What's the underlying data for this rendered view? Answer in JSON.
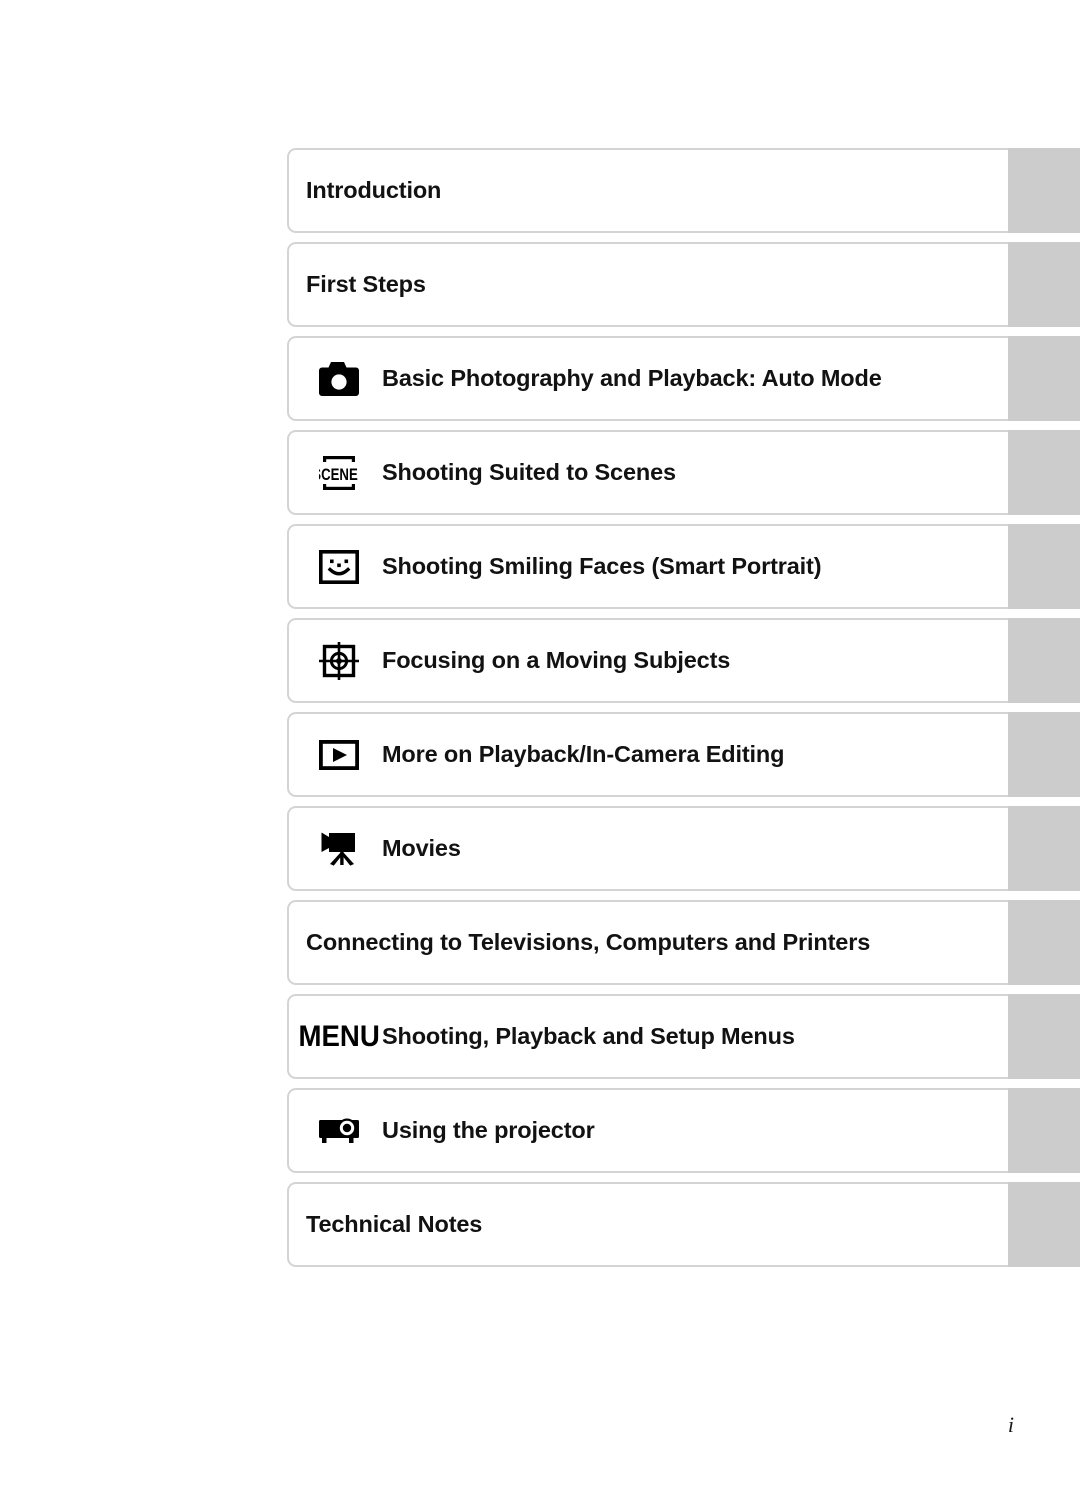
{
  "page": {
    "folio": "i",
    "background_color": "#ffffff",
    "tab_color": "#cccccc",
    "box_border_color": "#d4d4d4",
    "text_color": "#121212"
  },
  "contents": {
    "rows": [
      {
        "icon": "none",
        "label": "Introduction"
      },
      {
        "icon": "none",
        "label": "First Steps"
      },
      {
        "icon": "camera-icon",
        "label": "Basic Photography and Playback: Auto Mode"
      },
      {
        "icon": "scene-icon",
        "label": "Shooting Suited to Scenes"
      },
      {
        "icon": "smile-face-icon",
        "label": "Shooting Smiling Faces (Smart Portrait)"
      },
      {
        "icon": "focus-target-icon",
        "label": "Focusing on a Moving Subjects"
      },
      {
        "icon": "playback-icon",
        "label": "More on Playback/In-Camera Editing"
      },
      {
        "icon": "movie-camera-icon",
        "label": "Movies"
      },
      {
        "icon": "none",
        "label": "Connecting to Televisions, Computers and Printers"
      },
      {
        "icon": "menu-icon",
        "label": "Shooting, Playback and Setup Menus",
        "icon_text": "MENU"
      },
      {
        "icon": "projector-icon",
        "label": "Using the projector"
      },
      {
        "icon": "none",
        "label": "Technical Notes"
      }
    ]
  }
}
